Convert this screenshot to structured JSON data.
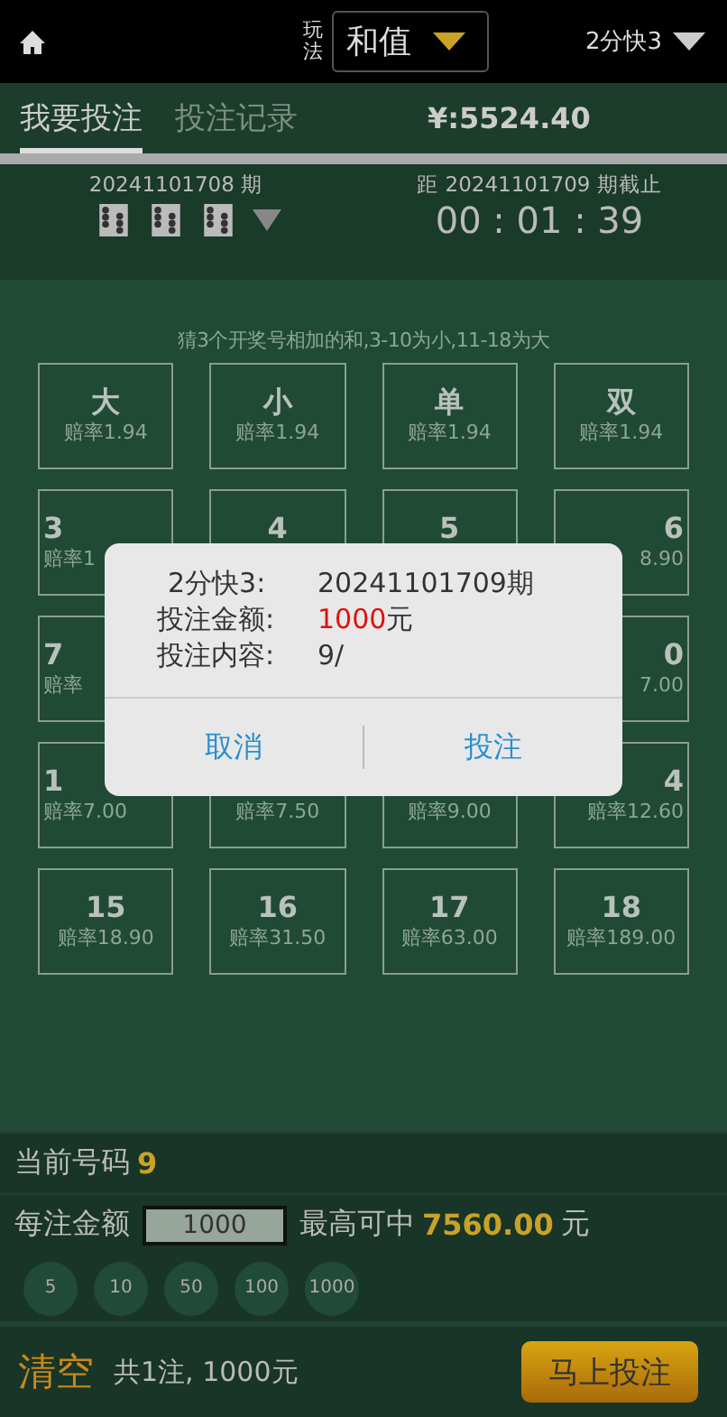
{
  "header": {
    "mode_label": "玩法",
    "mode": "和值",
    "game": "2分快3"
  },
  "tabs": [
    {
      "label": "我要投注",
      "selected": true
    },
    {
      "label": "投注记录",
      "selected": false
    }
  ],
  "balance": "¥:5524.40",
  "last_draw": {
    "issue": "20241101708 期"
  },
  "next_draw": {
    "label": "距 20241101709 期截止",
    "countdown": "00 : 01 : 39"
  },
  "hint": "猜3个开奖号相加的和,3-10为小,11-18为大",
  "cells": [
    {
      "number": "大",
      "odds": "赔率1.94",
      "kind": "center"
    },
    {
      "number": "小",
      "odds": "赔率1.94",
      "kind": "center"
    },
    {
      "number": "单",
      "odds": "赔率1.94",
      "kind": "center"
    },
    {
      "number": "双",
      "odds": "赔率1.94",
      "kind": "center"
    },
    {
      "number": "3",
      "odds": "赔率1",
      "kind": "left"
    },
    {
      "number": "4",
      "kind": "center"
    },
    {
      "number": "5",
      "kind": "center"
    },
    {
      "number": "6",
      "odds": "8.90",
      "kind": "right"
    },
    {
      "number": "7",
      "odds": "赔率",
      "kind": "left"
    },
    {
      "kind": "hidden"
    },
    {
      "kind": "hidden"
    },
    {
      "number": "0",
      "odds": "7.00",
      "kind": "right"
    },
    {
      "number": "1",
      "odds": "赔率7.00",
      "kind": "left"
    },
    {
      "odds": "赔率7.50",
      "kind": "center"
    },
    {
      "odds": "赔率9.00",
      "kind": "center"
    },
    {
      "number": "4",
      "odds": "赔率12.60",
      "kind": "right"
    },
    {
      "number": "15",
      "odds": "赔率18.90",
      "kind": "center"
    },
    {
      "number": "16",
      "odds": "赔率31.50",
      "kind": "center"
    },
    {
      "number": "17",
      "odds": "赔率63.00",
      "kind": "center"
    },
    {
      "number": "18",
      "odds": "赔率189.00",
      "kind": "center"
    }
  ],
  "current": {
    "label": "当前号码",
    "value": "9"
  },
  "stake": {
    "label": "每注金额",
    "value": "1000",
    "max_label": "最高可中",
    "max_value": "7560.00",
    "unit": "元"
  },
  "chips": [
    "5",
    "10",
    "50",
    "100",
    "1000"
  ],
  "footer": {
    "clear": "清空",
    "summary": "共1注, 1000元",
    "submit": "马上投注"
  },
  "dialog": {
    "game": "2分快3:",
    "issue": "20241101709期",
    "amount_label": "投注金额:",
    "amount": "1000",
    "amount_unit": "元",
    "content_label": "投注内容:",
    "content": "9/",
    "buttons": [
      "取消",
      "投注"
    ]
  }
}
